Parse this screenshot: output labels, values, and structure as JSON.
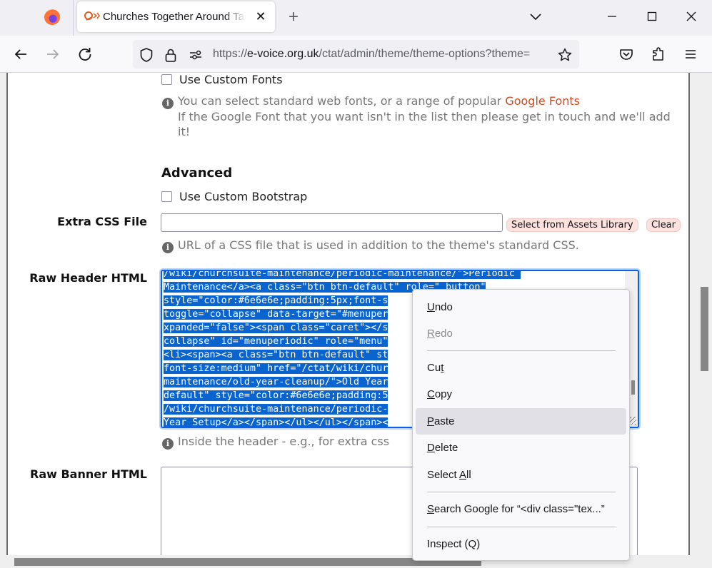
{
  "browser": {
    "tab_title": "Churches Together Around Tadley",
    "tab_favicon": "e-voice-logo-icon",
    "url_scheme": "https://",
    "url_host": "e-voice.org.uk",
    "url_path": "/ctat/admin/theme/theme-options?theme=",
    "icons": {
      "firefox": "firefox-logo-icon",
      "back": "back-arrow-icon",
      "forward": "forward-arrow-icon",
      "reload": "reload-icon",
      "shield": "tracking-shield-icon",
      "lock": "lock-icon",
      "permissions": "permissions-icon",
      "bookmark": "star-icon",
      "pocket": "pocket-icon",
      "extensions": "extensions-icon",
      "menu": "hamburger-menu-icon"
    },
    "new_tab_glyph": "+",
    "tab_close_glyph": "✕"
  },
  "form": {
    "custom_fonts": {
      "label": "Use Custom Fonts",
      "checked": false,
      "help_prefix": "You can select standard web fonts, or a range of popular ",
      "help_link": "Google Fonts",
      "help_line2": "If the Google Font that you want isn't in the list then please get in touch and we'll add it!"
    },
    "advanced": {
      "heading": "Advanced",
      "custom_bootstrap_label": "Use Custom Bootstrap",
      "custom_bootstrap_checked": false
    },
    "extra_css": {
      "label": "Extra CSS File",
      "value": "",
      "select_button": "Select from Assets Library",
      "clear_button": "Clear",
      "help": "URL of a CSS file that is used in addition to the theme's standard CSS."
    },
    "raw_header": {
      "label": "Raw Header HTML",
      "visible_lines": [
        "/wiki/churchsuite-maintenance/periodic-maintenance/\">Periodic ",
        "Maintenance</a><a class=\"btn btn-default\" role=\" button\"",
        "style=\"color:#6e6e6e;padding:5px;font-s",
        "toggle=\"collapse\" data-target=\"#menuper",
        "xpanded=\"false\"><span class=\"caret\"></s",
        "collapse\" id=\"menuperiodic\" role=\"menu\"",
        "<li><span><a class=\"btn btn-default\" st",
        "font-size:medium\" href=\"/ctat/wiki/chur",
        "maintenance/old-year-cleanup/\">Old Year",
        "default\" style=\"color:#6e6e6e;padding:5",
        "/wiki/churchsuite-maintenance/periodic-",
        "Year Setup</a></span></ul></ul></span><"
      ],
      "help": "Inside the header - e.g., for extra css"
    },
    "raw_banner": {
      "label": "Raw Banner HTML",
      "value": ""
    }
  },
  "context_menu": {
    "items": [
      {
        "label": "Undo",
        "accel": "U",
        "disabled": false
      },
      {
        "label": "Redo",
        "accel": "R",
        "disabled": true
      },
      {
        "label": "Cut",
        "accel": "t",
        "disabled": false
      },
      {
        "label": "Copy",
        "accel": "C",
        "disabled": false
      },
      {
        "label": "Paste",
        "accel": "P",
        "disabled": false,
        "hovered": true
      },
      {
        "label": "Delete",
        "accel": "D",
        "disabled": false
      },
      {
        "label": "Select All",
        "accel": "A",
        "disabled": false
      },
      {
        "label": "Search Google for “<div class=\"tex...”",
        "accel": "S",
        "disabled": false
      },
      {
        "label": "Inspect (Q)",
        "accel": "",
        "disabled": false
      }
    ]
  }
}
